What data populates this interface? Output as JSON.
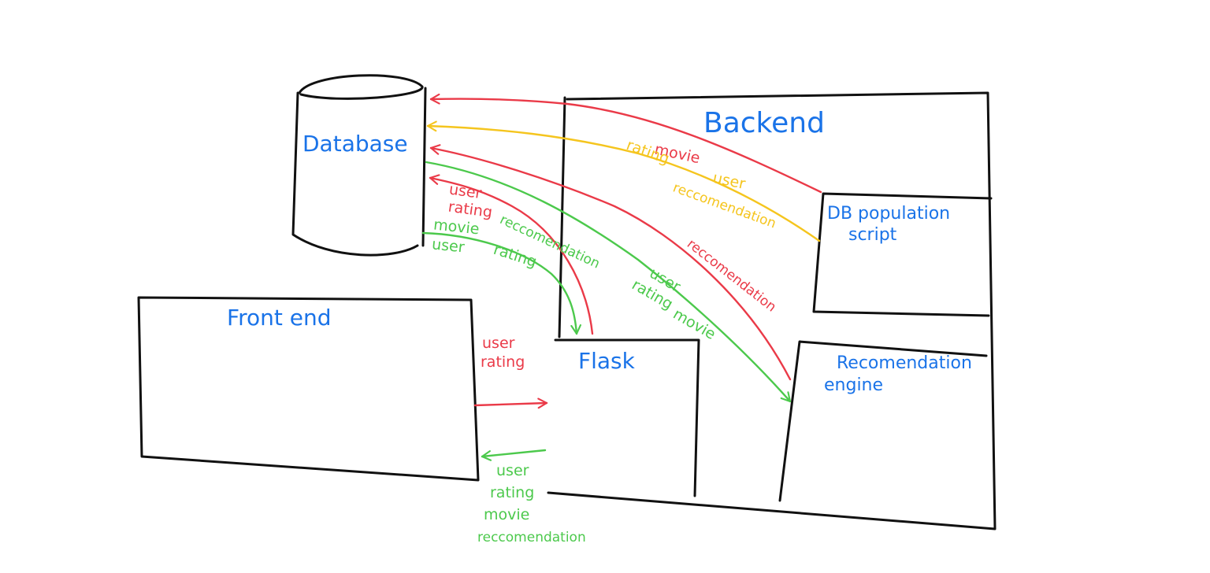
{
  "colors": {
    "background": "#ffffff",
    "outline": "#111111",
    "title": "#1a73e8",
    "red": "#ea3a48",
    "yellow": "#f5c51e",
    "green": "#4cc94c"
  },
  "nodes": {
    "database": "Database",
    "backend": "Backend",
    "frontend": "Front end",
    "flask": "Flask",
    "db_population_script": [
      "DB population",
      "script"
    ],
    "recommendation_engine": [
      "Recomendation",
      "engine"
    ]
  },
  "edges": {
    "db_script_to_database_red": [
      "movie",
      "user"
    ],
    "db_script_to_database_yellow": [
      "rating",
      "reccomendation"
    ],
    "engine_to_database_red": [
      "reccomendation"
    ],
    "database_to_engine_green": [
      "user",
      "rating",
      "movie"
    ],
    "flask_to_database_red": [
      "user",
      "rating"
    ],
    "database_to_flask_green": [
      "movie",
      "user",
      "reccomendation",
      "rating"
    ],
    "frontend_to_flask_red": [
      "user",
      "rating"
    ],
    "flask_to_frontend_green": [
      "user",
      "rating",
      "movie",
      "reccomendation"
    ]
  }
}
